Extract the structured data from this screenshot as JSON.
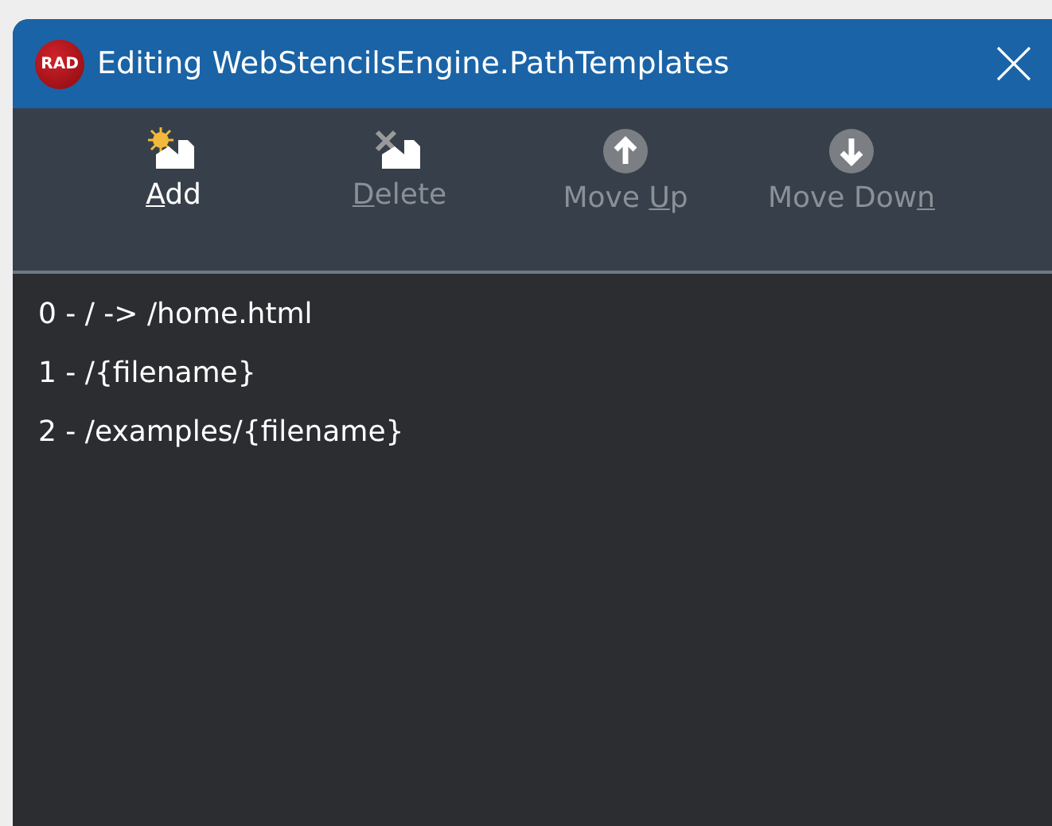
{
  "window": {
    "title": "Editing WebStencilsEngine.PathTemplates",
    "app_badge": "RAD"
  },
  "toolbar": [
    {
      "kind": "add",
      "key": "A",
      "after": "dd",
      "disabled": false
    },
    {
      "kind": "delete",
      "key": "D",
      "after": "elete",
      "disabled": true
    },
    {
      "kind": "up",
      "before": "Move ",
      "key": "U",
      "after": "p",
      "disabled": true
    },
    {
      "kind": "down",
      "before": "Move Dow",
      "key": "n",
      "disabled": true
    }
  ],
  "items": [
    {
      "label": "0 - / -> /home.html",
      "selected": false
    },
    {
      "label": "1 - /{filename}",
      "selected": false
    },
    {
      "label": "2 - /examples/{filename}",
      "selected": false
    }
  ]
}
